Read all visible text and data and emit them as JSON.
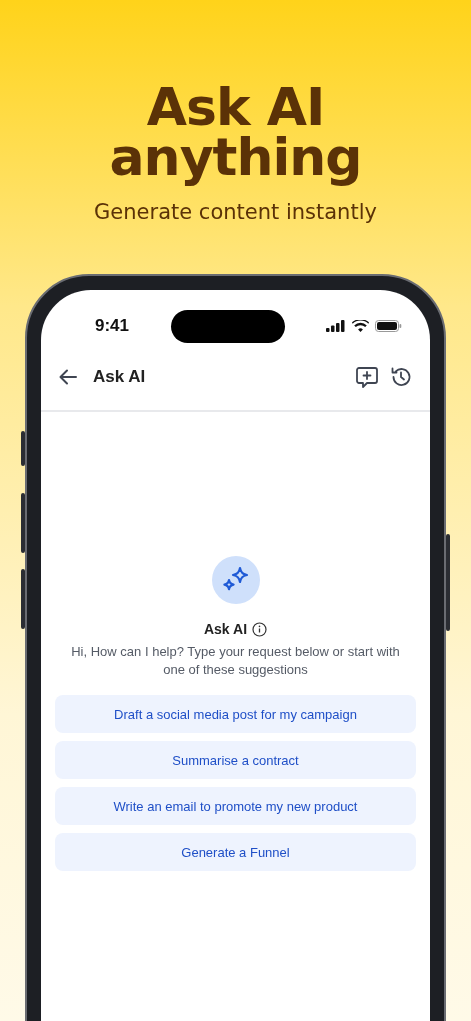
{
  "headline": {
    "title": "Ask AI anything",
    "subtitle": "Generate content instantly"
  },
  "status_bar": {
    "time": "9:41"
  },
  "app_bar": {
    "title": "Ask AI"
  },
  "assistant": {
    "title": "Ask AI",
    "message": "Hi, How can I help? Type your request below or start with one of these suggestions"
  },
  "suggestions": [
    {
      "label": "Draft a social media post for my campaign"
    },
    {
      "label": "Summarise a contract"
    },
    {
      "label": "Write an email to promote my new product"
    },
    {
      "label": "Generate a Funnel"
    }
  ]
}
